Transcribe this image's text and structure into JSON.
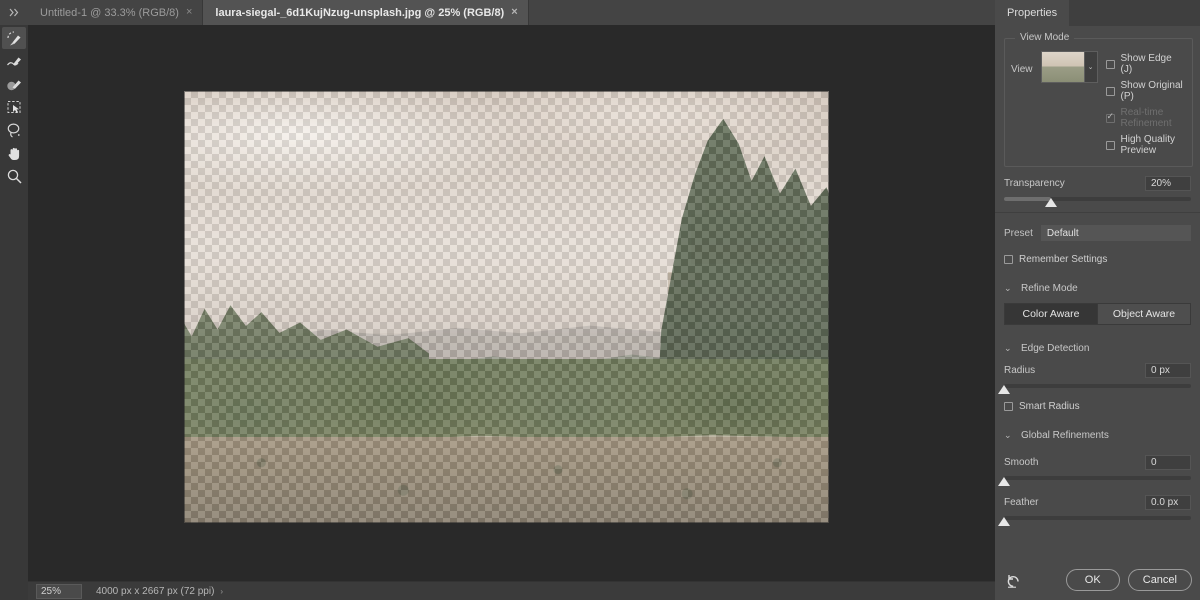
{
  "window": {
    "tabbar": {
      "expand_icon": "double-chevron-right-icon",
      "tabs": [
        {
          "label": "Untitled-1 @ 33.3% (RGB/8)",
          "close": "×",
          "active": false
        },
        {
          "label": "laura-siegal-_6d1KujNzug-unsplash.jpg @ 25% (RGB/8)",
          "close": "×",
          "active": true
        }
      ]
    }
  },
  "toolbar": {
    "tools": [
      {
        "name": "quick-selection-brush-tool",
        "selected": true
      },
      {
        "name": "refine-edge-brush-tool",
        "selected": false
      },
      {
        "name": "brush-tool",
        "selected": false
      },
      {
        "name": "object-selection-tool",
        "selected": false
      },
      {
        "name": "lasso-tool",
        "selected": false
      },
      {
        "name": "hand-tool",
        "selected": false
      },
      {
        "name": "zoom-tool",
        "selected": false
      }
    ]
  },
  "canvas": {
    "document_name": "laura-siegal-_6d1KujNzug-unsplash.jpg",
    "scroll_up_arrow": "▲",
    "scroll_down_arrow": "▼"
  },
  "statusbar": {
    "zoom": "25%",
    "doc_info": "4000 px x 2667 px (72 ppi)",
    "caret": "›"
  },
  "properties": {
    "panel_tab": "Properties",
    "view_mode": {
      "legend": "View Mode",
      "view_label": "View",
      "view_thumb_name": "view-mode-thumbnail",
      "dropdown_arrow": "⌄",
      "checkboxes": [
        {
          "label": "Show Edge (J)",
          "checked": false,
          "disabled": false
        },
        {
          "label": "Show Original (P)",
          "checked": false,
          "disabled": false
        },
        {
          "label": "Real-time Refinement",
          "checked": true,
          "disabled": true
        },
        {
          "label": "High Quality Preview",
          "checked": false,
          "disabled": false
        }
      ]
    },
    "transparency": {
      "label": "Transparency",
      "value": "20%",
      "fill_percent": 25
    },
    "preset": {
      "label": "Preset",
      "value": "Default"
    },
    "remember_settings": {
      "label": "Remember Settings",
      "checked": false
    },
    "refine_mode": {
      "twisty": "⌄",
      "title": "Refine Mode",
      "options": [
        {
          "label": "Color Aware",
          "active": true
        },
        {
          "label": "Object Aware",
          "active": false
        }
      ]
    },
    "edge_detection": {
      "twisty": "⌄",
      "title": "Edge Detection",
      "radius": {
        "label": "Radius",
        "value": "0 px",
        "fill_percent": 0
      },
      "smart_radius": {
        "label": "Smart Radius",
        "checked": false
      }
    },
    "global_refinements": {
      "twisty": "⌄",
      "title": "Global Refinements",
      "smooth": {
        "label": "Smooth",
        "value": "0",
        "fill_percent": 0
      },
      "feather": {
        "label": "Feather",
        "value": "0.0 px",
        "fill_percent": 0
      }
    },
    "footer": {
      "reset_icon": "reset-icon",
      "ok_label": "OK",
      "cancel_label": "Cancel"
    }
  }
}
